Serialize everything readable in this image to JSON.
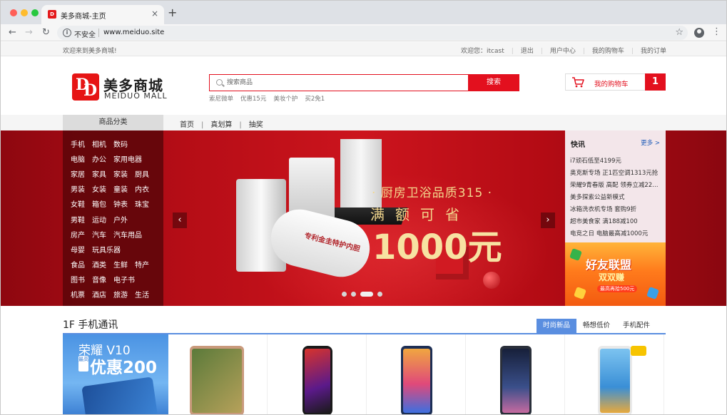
{
  "browser": {
    "tab_title": "美多商城-主页",
    "favicon_text": "D",
    "close_glyph": "×",
    "newtab_glyph": "+",
    "back_glyph": "←",
    "forward_glyph": "→",
    "reload_glyph": "↻",
    "insecure_label": "不安全",
    "url": "www.meiduo.site",
    "star_glyph": "☆",
    "menu_glyph": "⋮",
    "info_glyph": "i"
  },
  "site_bar": {
    "welcome": "欢迎来到美多商城!",
    "links": [
      "欢迎您：itcast",
      "退出",
      "用户中心",
      "我的购物车",
      "我的订单"
    ]
  },
  "header": {
    "logo_mark_1": "D",
    "logo_mark_2": "D",
    "logo_cn": "美多商城",
    "logo_en": "MEIDUO MALL",
    "search_placeholder": "搜索商品",
    "search_button": "搜索",
    "hot_words": [
      "索尼微单",
      "优惠15元",
      "美妆个护",
      "买2免1"
    ],
    "cart_label": "我的购物车",
    "cart_count": "1"
  },
  "nav": {
    "category_title": "商品分类",
    "items": [
      "首页",
      "真划算",
      "抽奖"
    ],
    "separator": "|"
  },
  "categories": [
    [
      "手机",
      "相机",
      "数码"
    ],
    [
      "电脑",
      "办公",
      "家用电器"
    ],
    [
      "家居",
      "家具",
      "家装",
      "厨具"
    ],
    [
      "男装",
      "女装",
      "童装",
      "内衣"
    ],
    [
      "女鞋",
      "箱包",
      "钟表",
      "珠宝"
    ],
    [
      "男鞋",
      "运动",
      "户外"
    ],
    [
      "房产",
      "汽车",
      "汽车用品"
    ],
    [
      "母婴",
      "玩具乐器"
    ],
    [
      "食品",
      "酒类",
      "生鲜",
      "特产"
    ],
    [
      "图书",
      "音像",
      "电子书"
    ],
    [
      "机票",
      "酒店",
      "旅游",
      "生活"
    ]
  ],
  "banner": {
    "line1": "· 厨房卫浴品质315 ·",
    "line2": "满额可省",
    "line3": "1000元",
    "product_label": "专利金圭特护内胆",
    "prev_glyph": "‹",
    "next_glyph": "›",
    "slide_count": 4,
    "active_slide": 3
  },
  "news": {
    "title": "快讯",
    "more": "更多 >",
    "items": [
      "i7顽石低至4199元",
      "奥克斯专场 正1匹空调1313元抢",
      "荣耀9青春版 高配 领券立减22…",
      "美多探索公益新模式",
      "冰箱洗衣机专场 套购9折",
      "超市美食家 满188减100",
      "电竞之日 电脑最高减1000元"
    ]
  },
  "side_ad": {
    "line1": "好友联盟",
    "line2": "双双赚",
    "line3": "最高再拾500元"
  },
  "floor": {
    "title": "1F 手机通讯",
    "tabs": [
      "时尚新品",
      "畅想低价",
      "手机配件"
    ],
    "active_tab": 0,
    "ad_brand": "荣耀 V10",
    "ad_badge": "最高",
    "ad_discount": "优惠200"
  },
  "colors": {
    "brand_red": "#e3101e",
    "accent_blue": "#5a8ee0"
  }
}
